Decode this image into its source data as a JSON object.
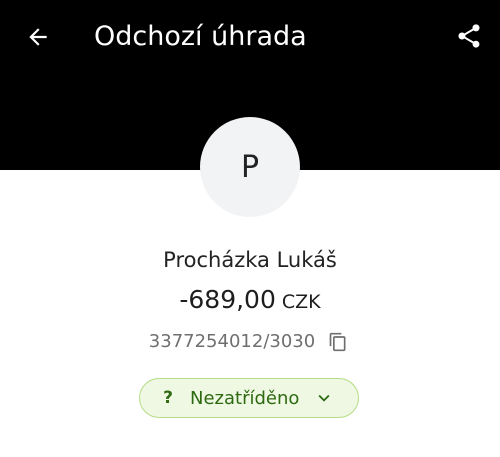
{
  "header": {
    "title": "Odchozí úhrada",
    "background": "#000000"
  },
  "transaction": {
    "avatar_initial": "P",
    "counterparty_name": "Procházka Lukáš",
    "amount": "-689,00",
    "currency": "CZK",
    "account_number": "3377254012/3030"
  },
  "category": {
    "icon": "?",
    "label": "Nezatříděno",
    "accent": "#2f6a13",
    "chip_background": "#eef8e3",
    "chip_border": "#b5dc86"
  },
  "icons": {
    "back": "arrow-left-icon",
    "share": "share-icon",
    "copy": "copy-icon",
    "dropdown": "chevron-down-icon"
  }
}
